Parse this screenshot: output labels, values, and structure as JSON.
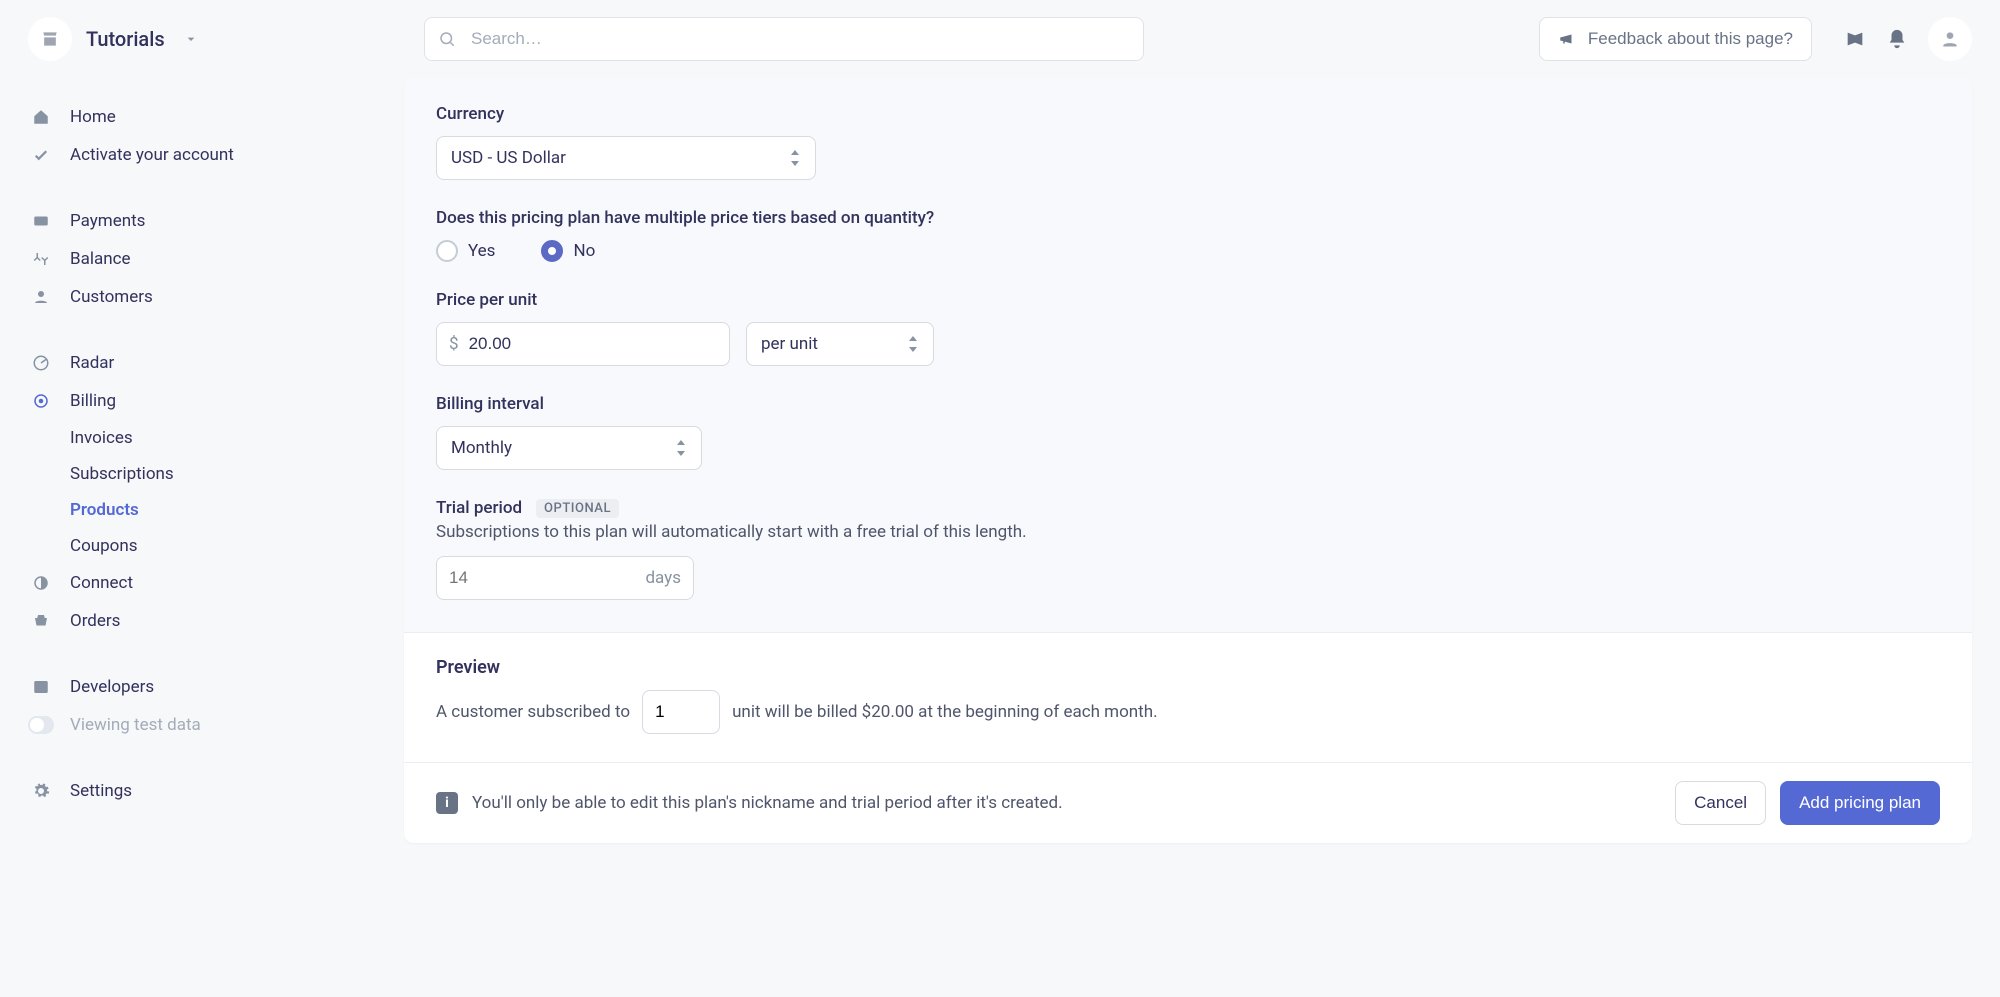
{
  "topbar": {
    "account_name": "Tutorials",
    "search_placeholder": "Search…",
    "feedback_label": "Feedback about this page?"
  },
  "sidebar": {
    "group1": [
      {
        "label": "Home"
      },
      {
        "label": "Activate your account"
      }
    ],
    "group2": [
      {
        "label": "Payments"
      },
      {
        "label": "Balance"
      },
      {
        "label": "Customers"
      }
    ],
    "group3": [
      {
        "label": "Radar"
      },
      {
        "label": "Billing"
      }
    ],
    "billing_sub": [
      {
        "label": "Invoices"
      },
      {
        "label": "Subscriptions"
      },
      {
        "label": "Products"
      },
      {
        "label": "Coupons"
      }
    ],
    "group4": [
      {
        "label": "Connect"
      },
      {
        "label": "Orders"
      }
    ],
    "group5": [
      {
        "label": "Developers"
      },
      {
        "label": "Viewing test data"
      }
    ],
    "settings_label": "Settings"
  },
  "form": {
    "currency_label": "Currency",
    "currency_value": "USD - US Dollar",
    "tiers_question": "Does this pricing plan have multiple price tiers based on quantity?",
    "radio_yes": "Yes",
    "radio_no": "No",
    "price_label": "Price per unit",
    "price_prefix": "$",
    "price_value": "20.00",
    "price_unit_value": "per unit",
    "interval_label": "Billing interval",
    "interval_value": "Monthly",
    "trial_label": "Trial period",
    "optional_badge": "OPTIONAL",
    "trial_help": "Subscriptions to this plan will automatically start with a free trial of this length.",
    "trial_placeholder": "14",
    "trial_suffix": "days"
  },
  "preview": {
    "title": "Preview",
    "text_pre": "A customer subscribed to",
    "quantity": "1",
    "text_post": "unit will be billed $20.00 at the beginning of each month."
  },
  "footer": {
    "info_text": "You'll only be able to edit this plan's nickname and trial period after it's created.",
    "cancel_label": "Cancel",
    "submit_label": "Add pricing plan"
  }
}
